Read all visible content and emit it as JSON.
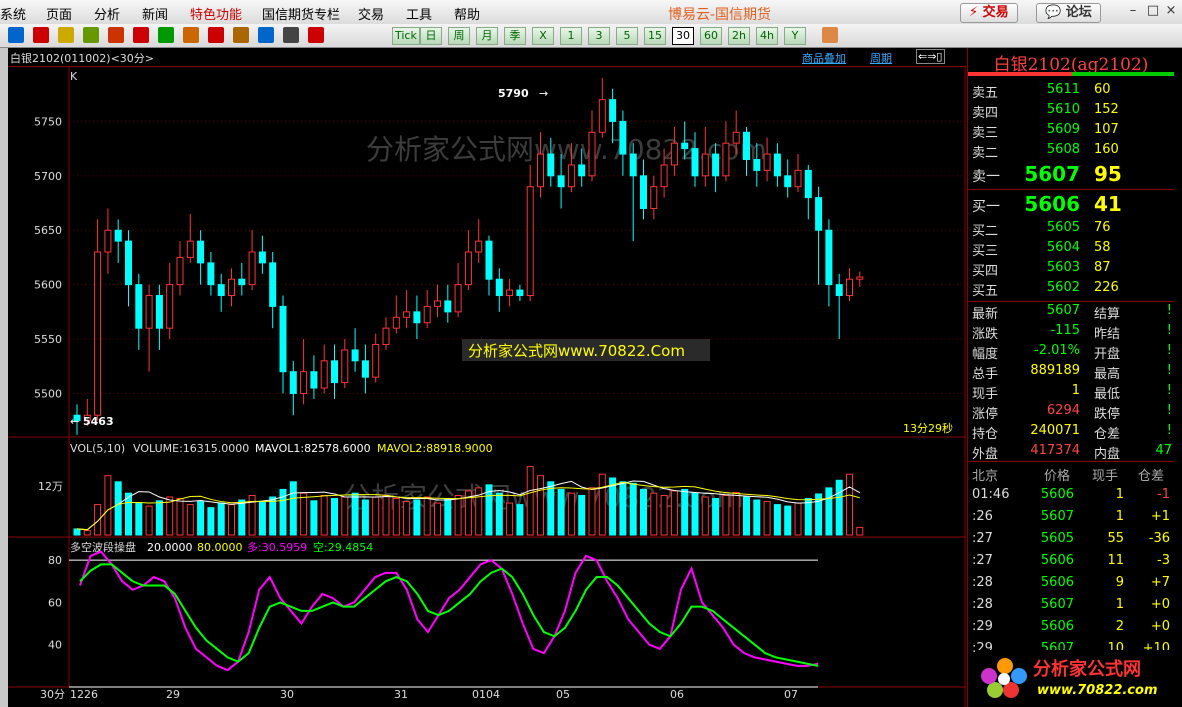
{
  "menu": {
    "items": [
      "系统",
      "页面",
      "分析",
      "新闻",
      "特色功能",
      "国信期货专栏",
      "交易",
      "工具",
      "帮助"
    ],
    "title": "博易云-国信期货",
    "trade_button": "交易",
    "forum_button": "论坛"
  },
  "toolbar": {
    "periods": [
      "Tick",
      "日",
      "周",
      "月",
      "季",
      "X",
      "1",
      "3",
      "5",
      "15",
      "30",
      "60",
      "2h",
      "4h",
      "Y"
    ],
    "active_period": "30"
  },
  "chart": {
    "symbol_label": "白银2102(011002)<30分>",
    "overlay_link": "商品叠加",
    "period_link": "周期",
    "k_label": "K",
    "price_ticks": [
      "5750",
      "5700",
      "5650",
      "5600",
      "5550",
      "5500"
    ],
    "high_marker": "5790",
    "low_marker": "5463",
    "countdown": "13分29秒",
    "vol_title": "VOL(5,10)",
    "volume": "VOLUME:16315.0000",
    "mavol1": "MAVOL1:82578.6000",
    "mavol2": "MAVOL2:88918.9000",
    "vol_tick": "12万",
    "ind_name": "多空波段操盘",
    "ind_p1": "20.0000",
    "ind_p2": "80.0000",
    "ind_duo": "多:30.5959",
    "ind_kong": "空:29.4854",
    "ind_ticks": [
      "80",
      "60",
      "40"
    ],
    "period_axis": "30分",
    "date_labels": [
      "1226",
      "29",
      "30",
      "31",
      "0104",
      "05",
      "06",
      "07"
    ],
    "watermark": "分析家公式网www.70822.com",
    "watermark_box": "分析家公式网www.70822.Com"
  },
  "chart_data": {
    "type": "candlestick",
    "price_range": [
      5460,
      5800
    ],
    "candles": [
      [
        5480,
        5475,
        5490,
        5462
      ],
      [
        5475,
        5480,
        5495,
        5470
      ],
      [
        5480,
        5630,
        5660,
        5475
      ],
      [
        5630,
        5650,
        5670,
        5610
      ],
      [
        5650,
        5640,
        5660,
        5620
      ],
      [
        5640,
        5600,
        5650,
        5580
      ],
      [
        5600,
        5560,
        5610,
        5540
      ],
      [
        5560,
        5590,
        5600,
        5520
      ],
      [
        5590,
        5560,
        5600,
        5540
      ],
      [
        5560,
        5600,
        5620,
        5550
      ],
      [
        5600,
        5625,
        5640,
        5590
      ],
      [
        5625,
        5640,
        5665,
        5620
      ],
      [
        5640,
        5620,
        5650,
        5600
      ],
      [
        5620,
        5600,
        5630,
        5590
      ],
      [
        5600,
        5590,
        5610,
        5575
      ],
      [
        5590,
        5605,
        5615,
        5580
      ],
      [
        5605,
        5600,
        5620,
        5590
      ],
      [
        5600,
        5630,
        5650,
        5595
      ],
      [
        5630,
        5620,
        5645,
        5610
      ],
      [
        5620,
        5580,
        5630,
        5560
      ],
      [
        5580,
        5520,
        5590,
        5500
      ],
      [
        5520,
        5500,
        5530,
        5480
      ],
      [
        5500,
        5520,
        5550,
        5490
      ],
      [
        5520,
        5505,
        5535,
        5495
      ],
      [
        5505,
        5530,
        5545,
        5500
      ],
      [
        5530,
        5510,
        5545,
        5495
      ],
      [
        5510,
        5540,
        5550,
        5505
      ],
      [
        5540,
        5530,
        5560,
        5520
      ],
      [
        5530,
        5515,
        5545,
        5500
      ],
      [
        5515,
        5545,
        5555,
        5510
      ],
      [
        5545,
        5560,
        5570,
        5540
      ],
      [
        5560,
        5570,
        5590,
        5555
      ],
      [
        5570,
        5575,
        5595,
        5560
      ],
      [
        5575,
        5565,
        5590,
        5550
      ],
      [
        5565,
        5580,
        5595,
        5560
      ],
      [
        5580,
        5585,
        5600,
        5570
      ],
      [
        5585,
        5575,
        5600,
        5565
      ],
      [
        5575,
        5600,
        5620,
        5570
      ],
      [
        5600,
        5630,
        5650,
        5595
      ],
      [
        5630,
        5640,
        5660,
        5620
      ],
      [
        5640,
        5605,
        5645,
        5590
      ],
      [
        5605,
        5590,
        5615,
        5575
      ],
      [
        5590,
        5595,
        5605,
        5580
      ],
      [
        5595,
        5590,
        5600,
        5585
      ],
      [
        5590,
        5690,
        5710,
        5585
      ],
      [
        5690,
        5720,
        5740,
        5680
      ],
      [
        5720,
        5700,
        5735,
        5690
      ],
      [
        5700,
        5690,
        5720,
        5670
      ],
      [
        5690,
        5710,
        5730,
        5685
      ],
      [
        5710,
        5700,
        5725,
        5690
      ],
      [
        5700,
        5740,
        5760,
        5695
      ],
      [
        5740,
        5770,
        5790,
        5735
      ],
      [
        5770,
        5750,
        5780,
        5730
      ],
      [
        5750,
        5720,
        5760,
        5700
      ],
      [
        5720,
        5700,
        5730,
        5640
      ],
      [
        5700,
        5670,
        5715,
        5660
      ],
      [
        5670,
        5690,
        5700,
        5660
      ],
      [
        5690,
        5710,
        5725,
        5680
      ],
      [
        5710,
        5730,
        5745,
        5700
      ],
      [
        5730,
        5725,
        5750,
        5715
      ],
      [
        5725,
        5700,
        5740,
        5690
      ],
      [
        5700,
        5720,
        5745,
        5690
      ],
      [
        5720,
        5700,
        5730,
        5685
      ],
      [
        5700,
        5730,
        5750,
        5695
      ],
      [
        5730,
        5740,
        5760,
        5720
      ],
      [
        5740,
        5715,
        5745,
        5700
      ],
      [
        5715,
        5705,
        5730,
        5690
      ],
      [
        5705,
        5720,
        5735,
        5695
      ],
      [
        5720,
        5700,
        5730,
        5690
      ],
      [
        5700,
        5690,
        5715,
        5680
      ],
      [
        5690,
        5705,
        5720,
        5685
      ],
      [
        5705,
        5680,
        5710,
        5660
      ],
      [
        5680,
        5650,
        5690,
        5600
      ],
      [
        5650,
        5600,
        5660,
        5580
      ],
      [
        5600,
        5590,
        5610,
        5550
      ],
      [
        5590,
        5605,
        5615,
        5585
      ],
      [
        5605,
        5607,
        5612,
        5598
      ]
    ],
    "volumes": [
      8,
      6,
      40,
      78,
      70,
      55,
      42,
      38,
      45,
      50,
      48,
      40,
      44,
      36,
      42,
      40,
      46,
      52,
      44,
      50,
      60,
      70,
      55,
      45,
      52,
      48,
      50,
      55,
      46,
      50,
      52,
      48,
      44,
      46,
      50,
      42,
      48,
      52,
      58,
      62,
      66,
      55,
      42,
      40,
      90,
      78,
      70,
      60,
      55,
      52,
      62,
      80,
      75,
      70,
      68,
      60,
      55,
      52,
      58,
      60,
      55,
      50,
      48,
      52,
      56,
      50,
      46,
      44,
      40,
      38,
      42,
      48,
      54,
      62,
      72,
      80,
      10
    ],
    "indicator": {
      "ylim": [
        20,
        90
      ],
      "duo": [
        68,
        82,
        84,
        78,
        70,
        66,
        68,
        72,
        70,
        62,
        48,
        38,
        34,
        30,
        28,
        32,
        46,
        66,
        72,
        62,
        56,
        50,
        58,
        64,
        62,
        58,
        60,
        66,
        72,
        74,
        74,
        66,
        52,
        46,
        54,
        62,
        66,
        72,
        78,
        80,
        76,
        64,
        50,
        38,
        36,
        44,
        56,
        74,
        82,
        80,
        70,
        62,
        52,
        46,
        40,
        38,
        44,
        66,
        76,
        60,
        54,
        48,
        40,
        36,
        34,
        33,
        32,
        31,
        30,
        30,
        31
      ],
      "kong": [
        70,
        75,
        78,
        78,
        74,
        70,
        68,
        68,
        68,
        64,
        56,
        48,
        42,
        38,
        34,
        32,
        36,
        48,
        58,
        60,
        58,
        56,
        56,
        58,
        60,
        58,
        58,
        62,
        66,
        70,
        72,
        70,
        64,
        56,
        54,
        56,
        60,
        64,
        70,
        74,
        76,
        72,
        64,
        54,
        46,
        44,
        48,
        56,
        66,
        72,
        72,
        68,
        62,
        56,
        50,
        46,
        44,
        50,
        58,
        58,
        56,
        52,
        48,
        44,
        40,
        36,
        34,
        33,
        32,
        31,
        30
      ]
    }
  },
  "quote": {
    "title": "白银2102(ag2102)",
    "asks": [
      {
        "label": "卖五",
        "price": "5611",
        "vol": "60"
      },
      {
        "label": "卖四",
        "price": "5610",
        "vol": "152"
      },
      {
        "label": "卖三",
        "price": "5609",
        "vol": "107"
      },
      {
        "label": "卖二",
        "price": "5608",
        "vol": "160"
      },
      {
        "label": "卖一",
        "price": "5607",
        "vol": "95"
      }
    ],
    "bids": [
      {
        "label": "买一",
        "price": "5606",
        "vol": "41"
      },
      {
        "label": "买二",
        "price": "5605",
        "vol": "76"
      },
      {
        "label": "买三",
        "price": "5604",
        "vol": "58"
      },
      {
        "label": "买四",
        "price": "5603",
        "vol": "87"
      },
      {
        "label": "买五",
        "price": "5602",
        "vol": "226"
      }
    ],
    "stats": [
      {
        "l1": "最新",
        "v1": "5607",
        "c1": "#0f0",
        "l2": "结算",
        "v2": "!",
        "c2": "#0f0"
      },
      {
        "l1": "涨跌",
        "v1": "-115",
        "c1": "#0f0",
        "l2": "昨结",
        "v2": "!",
        "c2": "#0f0"
      },
      {
        "l1": "幅度",
        "v1": "-2.01%",
        "c1": "#0f0",
        "l2": "开盘",
        "v2": "!",
        "c2": "#0f0"
      },
      {
        "l1": "总手",
        "v1": "889189",
        "c1": "#ff0",
        "l2": "最高",
        "v2": "!",
        "c2": "#0f0"
      },
      {
        "l1": "现手",
        "v1": "1",
        "c1": "#ff0",
        "l2": "最低",
        "v2": "!",
        "c2": "#0f0"
      },
      {
        "l1": "涨停",
        "v1": "6294",
        "c1": "#f44",
        "l2": "跌停",
        "v2": "!",
        "c2": "#0f0"
      },
      {
        "l1": "持仓",
        "v1": "240071",
        "c1": "#ff0",
        "l2": "仓差",
        "v2": "!",
        "c2": "#0f0"
      },
      {
        "l1": "外盘",
        "v1": "417374",
        "c1": "#f44",
        "l2": "内盘",
        "v2": "47",
        "c2": "#0f0"
      }
    ],
    "ticks_header": [
      "北京",
      "价格",
      "现手",
      "仓差"
    ],
    "ticks": [
      {
        "time": "01:46",
        "price": "5606",
        "vol": "1",
        "diff": "-1",
        "dc": "#f44"
      },
      {
        "time": ":26",
        "price": "5607",
        "vol": "1",
        "diff": "+1",
        "dc": "#ff0"
      },
      {
        "time": ":27",
        "price": "5605",
        "vol": "55",
        "diff": "-36",
        "dc": "#ff0"
      },
      {
        "time": ":27",
        "price": "5606",
        "vol": "11",
        "diff": "-3",
        "dc": "#ff0"
      },
      {
        "time": ":28",
        "price": "5606",
        "vol": "9",
        "diff": "+7",
        "dc": "#ff0"
      },
      {
        "time": ":28",
        "price": "5607",
        "vol": "1",
        "diff": "+0",
        "dc": "#ff0"
      },
      {
        "time": ":29",
        "price": "5606",
        "vol": "2",
        "diff": "+0",
        "dc": "#ff0"
      },
      {
        "time": ":29",
        "price": "5607",
        "vol": "10",
        "diff": "+10",
        "dc": "#ff0"
      }
    ],
    "logo_text": "分析家公式网",
    "logo_url": "www.70822.com"
  }
}
